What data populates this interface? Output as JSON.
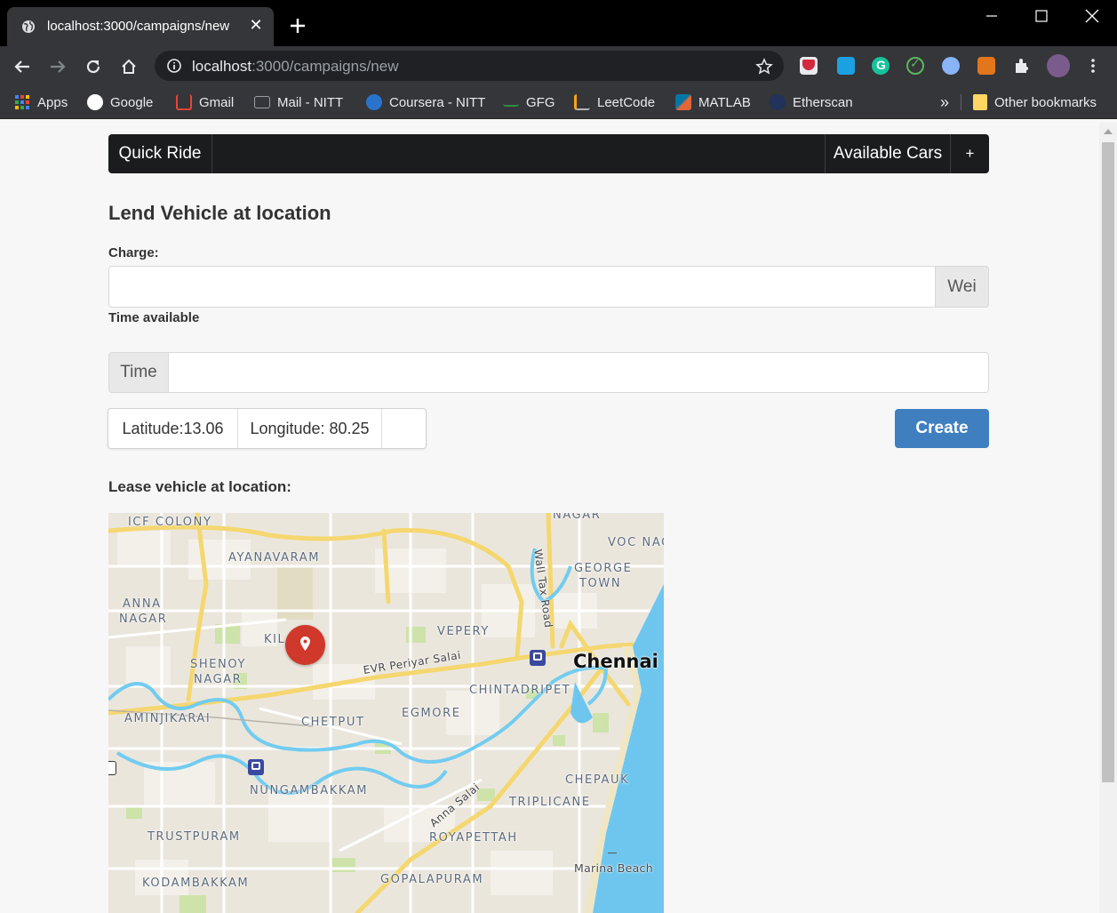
{
  "browser": {
    "tab_title": "localhost:3000/campaigns/new",
    "url_host": "localhost",
    "url_rest": ":3000/campaigns/new",
    "bookmarks": [
      {
        "label": "Apps",
        "icon": "apps-grid-icon"
      },
      {
        "label": "Google",
        "icon": "google-icon"
      },
      {
        "label": "Gmail",
        "icon": "gmail-icon"
      },
      {
        "label": "Mail - NITT",
        "icon": "mail-icon"
      },
      {
        "label": "Coursera - NITT",
        "icon": "coursera-icon"
      },
      {
        "label": "GFG",
        "icon": "gfg-icon"
      },
      {
        "label": "LeetCode",
        "icon": "leetcode-icon"
      },
      {
        "label": "MATLAB",
        "icon": "matlab-icon"
      },
      {
        "label": "Etherscan",
        "icon": "etherscan-icon"
      }
    ],
    "bookmarks_overflow": "»",
    "other_bookmarks": "Other bookmarks"
  },
  "nav": {
    "brand": "Quick Ride",
    "available_cars": "Available Cars",
    "add": "+"
  },
  "form": {
    "heading": "Lend Vehicle at location",
    "charge_label": "Charge:",
    "charge_value": "",
    "charge_unit": "Wei",
    "time_label": "Time available",
    "time_prefix": "Time",
    "time_value": "",
    "latitude": "Latitude:13.06",
    "longitude": "Longitude: 80.25",
    "create_button": "Create",
    "lease_label": "Lease vehicle at location:"
  },
  "map": {
    "labels": {
      "icf_colony": "ICF COLONY",
      "nagar_top": "NAGAR",
      "voc_nagar": "VOC NAG",
      "ayanavaram": "AYANAVARAM",
      "george": "GEORGE",
      "town": "TOWN",
      "anna": "ANNA",
      "nagar": "NAGAR",
      "kil": "KIL",
      "vepery": "VEPERY",
      "chennai": "Chennai",
      "shenoy": "SHENOY",
      "shenoy_nagar": "NAGAR",
      "evr": "EVR Periyar Salai",
      "chintadripet": "CHINTADRIPET",
      "aminjikarai": "AMINJIKARAI",
      "chetput": "CHETPUT",
      "egmore": "EGMORE",
      "chepauk": "CHEPAUK",
      "nungambakkam": "NUNGAMBAKKAM",
      "anna_salai": "Anna Salai",
      "triplicane": "TRIPLICANE",
      "trustpuram": "TRUSTPURAM",
      "royapettah": "ROYAPETTAH",
      "marina": "Marina Beach",
      "kodambakkam": "KODAMBAKKAM",
      "gopalapuram": "GOPALAPURAM",
      "wall_tax": "Wall Tax Road"
    }
  }
}
